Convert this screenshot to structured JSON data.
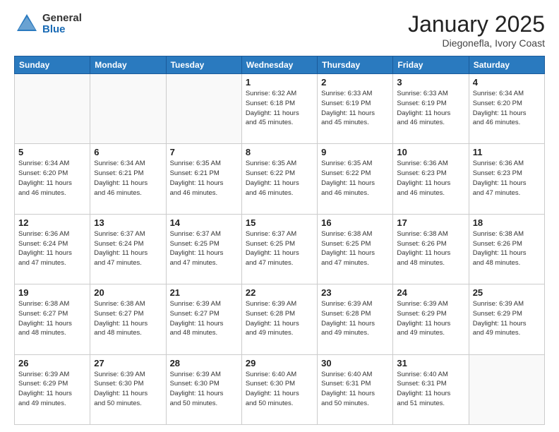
{
  "header": {
    "logo_general": "General",
    "logo_blue": "Blue",
    "month_title": "January 2025",
    "location": "Diegonefla, Ivory Coast"
  },
  "weekdays": [
    "Sunday",
    "Monday",
    "Tuesday",
    "Wednesday",
    "Thursday",
    "Friday",
    "Saturday"
  ],
  "weeks": [
    [
      {
        "day": "",
        "info": ""
      },
      {
        "day": "",
        "info": ""
      },
      {
        "day": "",
        "info": ""
      },
      {
        "day": "1",
        "info": "Sunrise: 6:32 AM\nSunset: 6:18 PM\nDaylight: 11 hours\nand 45 minutes."
      },
      {
        "day": "2",
        "info": "Sunrise: 6:33 AM\nSunset: 6:19 PM\nDaylight: 11 hours\nand 45 minutes."
      },
      {
        "day": "3",
        "info": "Sunrise: 6:33 AM\nSunset: 6:19 PM\nDaylight: 11 hours\nand 46 minutes."
      },
      {
        "day": "4",
        "info": "Sunrise: 6:34 AM\nSunset: 6:20 PM\nDaylight: 11 hours\nand 46 minutes."
      }
    ],
    [
      {
        "day": "5",
        "info": "Sunrise: 6:34 AM\nSunset: 6:20 PM\nDaylight: 11 hours\nand 46 minutes."
      },
      {
        "day": "6",
        "info": "Sunrise: 6:34 AM\nSunset: 6:21 PM\nDaylight: 11 hours\nand 46 minutes."
      },
      {
        "day": "7",
        "info": "Sunrise: 6:35 AM\nSunset: 6:21 PM\nDaylight: 11 hours\nand 46 minutes."
      },
      {
        "day": "8",
        "info": "Sunrise: 6:35 AM\nSunset: 6:22 PM\nDaylight: 11 hours\nand 46 minutes."
      },
      {
        "day": "9",
        "info": "Sunrise: 6:35 AM\nSunset: 6:22 PM\nDaylight: 11 hours\nand 46 minutes."
      },
      {
        "day": "10",
        "info": "Sunrise: 6:36 AM\nSunset: 6:23 PM\nDaylight: 11 hours\nand 46 minutes."
      },
      {
        "day": "11",
        "info": "Sunrise: 6:36 AM\nSunset: 6:23 PM\nDaylight: 11 hours\nand 47 minutes."
      }
    ],
    [
      {
        "day": "12",
        "info": "Sunrise: 6:36 AM\nSunset: 6:24 PM\nDaylight: 11 hours\nand 47 minutes."
      },
      {
        "day": "13",
        "info": "Sunrise: 6:37 AM\nSunset: 6:24 PM\nDaylight: 11 hours\nand 47 minutes."
      },
      {
        "day": "14",
        "info": "Sunrise: 6:37 AM\nSunset: 6:25 PM\nDaylight: 11 hours\nand 47 minutes."
      },
      {
        "day": "15",
        "info": "Sunrise: 6:37 AM\nSunset: 6:25 PM\nDaylight: 11 hours\nand 47 minutes."
      },
      {
        "day": "16",
        "info": "Sunrise: 6:38 AM\nSunset: 6:25 PM\nDaylight: 11 hours\nand 47 minutes."
      },
      {
        "day": "17",
        "info": "Sunrise: 6:38 AM\nSunset: 6:26 PM\nDaylight: 11 hours\nand 48 minutes."
      },
      {
        "day": "18",
        "info": "Sunrise: 6:38 AM\nSunset: 6:26 PM\nDaylight: 11 hours\nand 48 minutes."
      }
    ],
    [
      {
        "day": "19",
        "info": "Sunrise: 6:38 AM\nSunset: 6:27 PM\nDaylight: 11 hours\nand 48 minutes."
      },
      {
        "day": "20",
        "info": "Sunrise: 6:38 AM\nSunset: 6:27 PM\nDaylight: 11 hours\nand 48 minutes."
      },
      {
        "day": "21",
        "info": "Sunrise: 6:39 AM\nSunset: 6:27 PM\nDaylight: 11 hours\nand 48 minutes."
      },
      {
        "day": "22",
        "info": "Sunrise: 6:39 AM\nSunset: 6:28 PM\nDaylight: 11 hours\nand 49 minutes."
      },
      {
        "day": "23",
        "info": "Sunrise: 6:39 AM\nSunset: 6:28 PM\nDaylight: 11 hours\nand 49 minutes."
      },
      {
        "day": "24",
        "info": "Sunrise: 6:39 AM\nSunset: 6:29 PM\nDaylight: 11 hours\nand 49 minutes."
      },
      {
        "day": "25",
        "info": "Sunrise: 6:39 AM\nSunset: 6:29 PM\nDaylight: 11 hours\nand 49 minutes."
      }
    ],
    [
      {
        "day": "26",
        "info": "Sunrise: 6:39 AM\nSunset: 6:29 PM\nDaylight: 11 hours\nand 49 minutes."
      },
      {
        "day": "27",
        "info": "Sunrise: 6:39 AM\nSunset: 6:30 PM\nDaylight: 11 hours\nand 50 minutes."
      },
      {
        "day": "28",
        "info": "Sunrise: 6:39 AM\nSunset: 6:30 PM\nDaylight: 11 hours\nand 50 minutes."
      },
      {
        "day": "29",
        "info": "Sunrise: 6:40 AM\nSunset: 6:30 PM\nDaylight: 11 hours\nand 50 minutes."
      },
      {
        "day": "30",
        "info": "Sunrise: 6:40 AM\nSunset: 6:31 PM\nDaylight: 11 hours\nand 50 minutes."
      },
      {
        "day": "31",
        "info": "Sunrise: 6:40 AM\nSunset: 6:31 PM\nDaylight: 11 hours\nand 51 minutes."
      },
      {
        "day": "",
        "info": ""
      }
    ]
  ]
}
